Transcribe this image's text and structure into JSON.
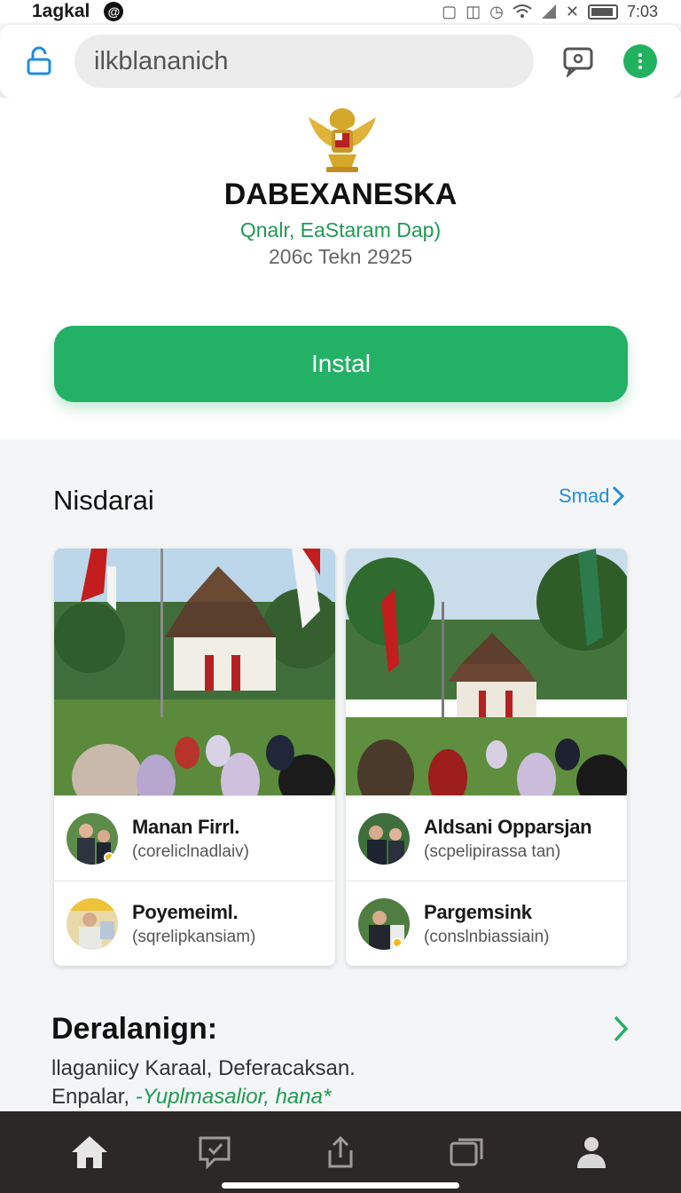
{
  "status_bar": {
    "carrier": "1agkal",
    "time": "7:03",
    "icons": [
      "dnd-icon",
      "vibrate-icon",
      "alarm-icon",
      "wifi-icon",
      "signal-icon",
      "no-sim-icon",
      "battery-icon"
    ]
  },
  "browser": {
    "url": "ilkblananich",
    "icons": [
      "lock-icon",
      "chat-icon",
      "menu-dots-icon"
    ]
  },
  "app": {
    "title": "DABEXANESKA",
    "subtitle": "Qnalr, EaStaram Dap)",
    "meta": "206c Tekn 2925",
    "install_label": "Instal"
  },
  "section": {
    "title": "Nisdarai",
    "see_all": "Smad"
  },
  "cards": [
    {
      "people": [
        {
          "name": "Manan Firrl.",
          "role": "(coreliclnadlaiv)"
        },
        {
          "name": "Poyemeiml.",
          "role": "(sqrelipkansiam)"
        }
      ]
    },
    {
      "people": [
        {
          "name": "Aldsani Opparsjan",
          "role": "(scpelipirassa tan)"
        },
        {
          "name": "Pargemsink",
          "role": "(conslnbiassiain)"
        }
      ]
    }
  ],
  "description": {
    "title": "Deralanign:",
    "line1": "llaganiicy Karaal, Deferacaksan.",
    "line2_prefix": "Enpalar, ",
    "line2_link": "-Yuplmasalior, hana*"
  },
  "bottom_nav": [
    "home-icon",
    "feedback-icon",
    "share-icon",
    "windows-icon",
    "profile-icon"
  ],
  "colors": {
    "accent_green": "#23b165",
    "link_blue": "#1f8de0",
    "nav_bg": "#2c2828"
  }
}
